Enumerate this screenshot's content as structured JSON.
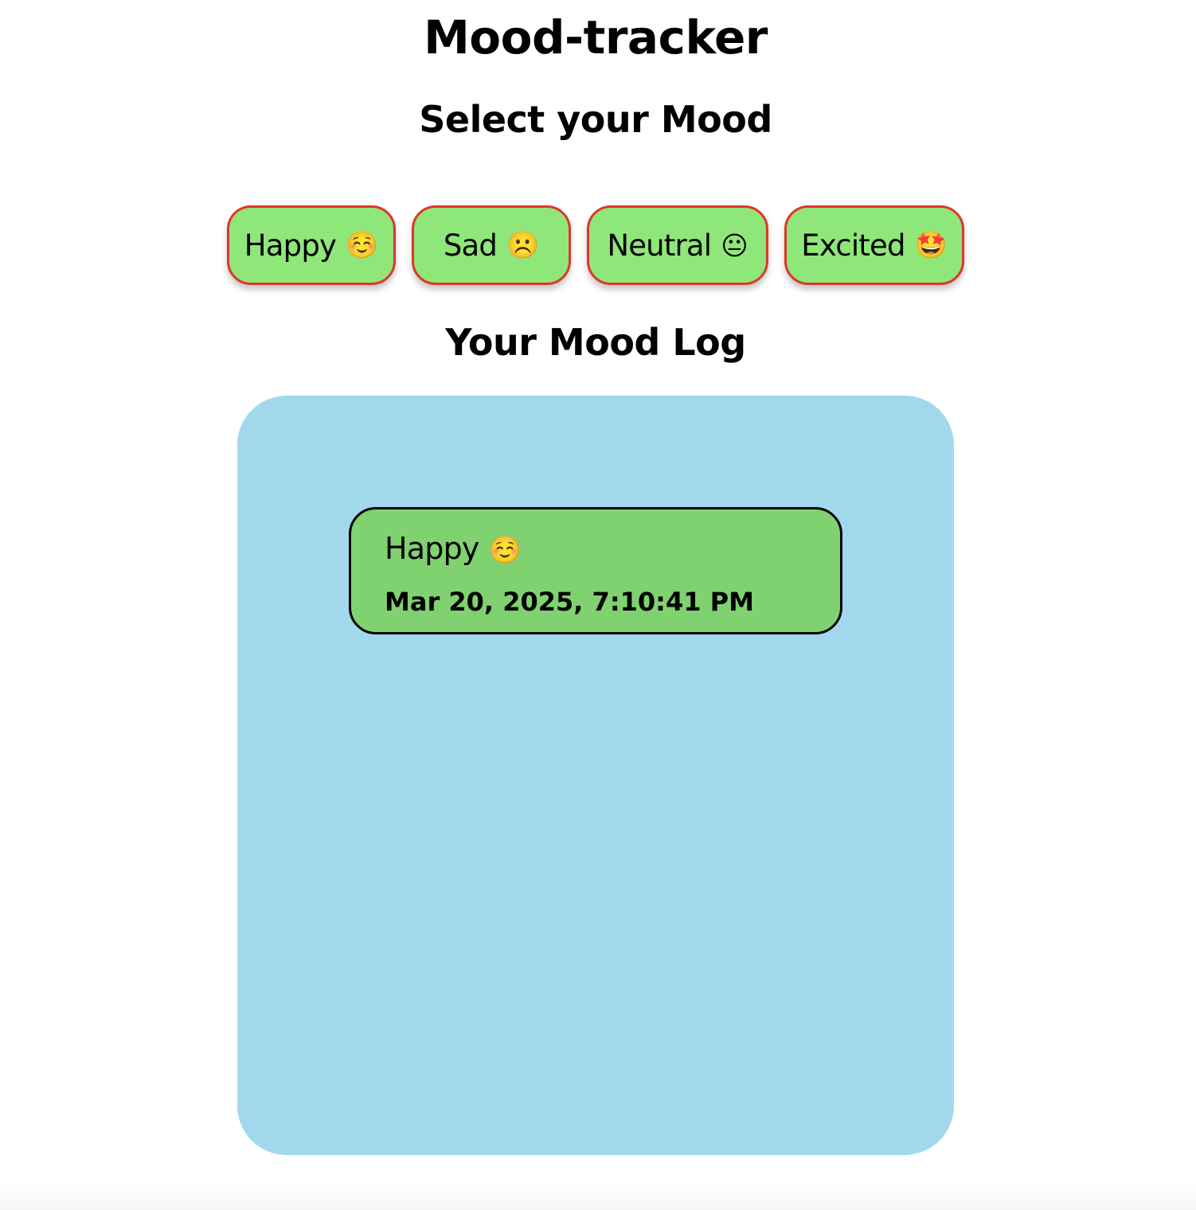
{
  "app": {
    "title": "Mood-tracker"
  },
  "selector": {
    "heading": "Select your Mood",
    "moods": [
      {
        "label": "Happy",
        "emoji": "☺️"
      },
      {
        "label": "Sad",
        "emoji": "☹️"
      },
      {
        "label": "Neutral",
        "emoji": "😐"
      },
      {
        "label": "Excited",
        "emoji": "🤩"
      }
    ]
  },
  "log": {
    "heading": "Your Mood Log",
    "entries": [
      {
        "mood": "Happy",
        "emoji": "☺️",
        "timestamp": "Mar 20, 2025, 7:10:41 PM"
      }
    ]
  },
  "colors": {
    "mood_button_bg": "#8fe779",
    "mood_button_border": "#e0352b",
    "log_panel_bg": "#a2d8ec",
    "log_entry_bg": "#80d16f",
    "log_entry_border": "#000000"
  }
}
